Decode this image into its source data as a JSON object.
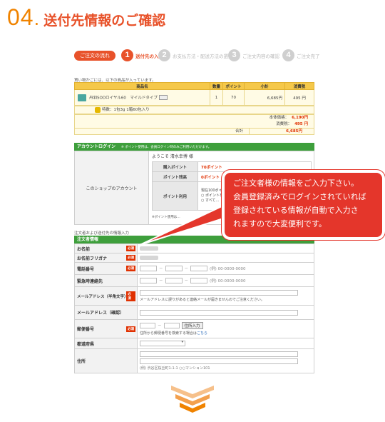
{
  "heading": {
    "number": "04",
    "dot": ".",
    "title": "送付先情報のご確認"
  },
  "steps": {
    "flow_label": "ご注文の流れ",
    "items": [
      {
        "num": "1",
        "label": "送付先の入力",
        "active": true
      },
      {
        "num": "2",
        "label": "お支払方法・配送方法の選択",
        "active": false
      },
      {
        "num": "3",
        "label": "ご注文内容の確認",
        "active": false
      },
      {
        "num": "4",
        "label": "ご注文完了",
        "active": false
      }
    ]
  },
  "cart": {
    "intro": "買い物かごには、以下の商品が入っています。",
    "headers": [
      "商品名",
      "数量",
      "ポイント",
      "小計",
      "消費税"
    ],
    "row": {
      "product": "丹羽SODロイヤル60　マイルドタイプ",
      "qty": "1",
      "points": "70",
      "subtotal": "6,685円",
      "tax": "495 円"
    },
    "detail": "特数：1包3g 1箱60包入り",
    "totals": {
      "body_label": "本体価格：",
      "body_value": "6,190円",
      "tax_label": "消費税：",
      "tax_value": "495 円",
      "grand_label": "合計",
      "grand_value": "6,685円"
    }
  },
  "account": {
    "header": "アカウントログイン",
    "header_note": "※ ポイント使用は、会員ログイン時のみご利用いただけます。",
    "left_label": "このショップのアカウント",
    "welcome": "ようこそ 清水幸博 様",
    "rows": [
      {
        "label": "購入ポイント",
        "value": "70ポイント"
      },
      {
        "label": "ポイント残高",
        "value": "0ポイント"
      },
      {
        "label": "ポイント利用",
        "value": "現在100ポイ…",
        "opt1": "○ ポイントを…",
        "opt2": "○ すべて…"
      }
    ],
    "footnote": "※ポイント使用は…"
  },
  "form": {
    "intro": "注文者および送付先の情報入力",
    "header": "注文者情報",
    "required": "必須",
    "rows": {
      "name": "お名前",
      "kana": "お名前フリガナ",
      "phone": "電話番号",
      "phone_example": "(例) 00-0000-0000",
      "emergency": "緊急時連絡先",
      "emergency_example": "(例) 00-0000-0000",
      "email": "メールアドレス（半角文字）",
      "email_note": "メールアドレスに誤りがあると連絡メールが届きませんのでご注意ください。",
      "email_confirm": "メールアドレス（確認）",
      "zip": "郵便番号",
      "zip_button": "住所入力",
      "zip_note": "住所から郵便番号を検索する場合は",
      "zip_link": "こちら",
      "pref": "都道府県",
      "address": "住所",
      "address_example": "(例) 渋谷区桜丘町1-1-1 ○○マンション101"
    },
    "separator": "－"
  },
  "callout": {
    "lines": [
      "ご注文者様の情報をご入力下さい。",
      "会員登録済みでログインされていれば",
      "登録されている情報が自動で入力さ",
      "れますので大変便利です。"
    ]
  },
  "colors": {
    "accent": "#e4362b",
    "orange": "#f08300",
    "green": "#3e9f3c",
    "gold": "#f5c84a"
  }
}
